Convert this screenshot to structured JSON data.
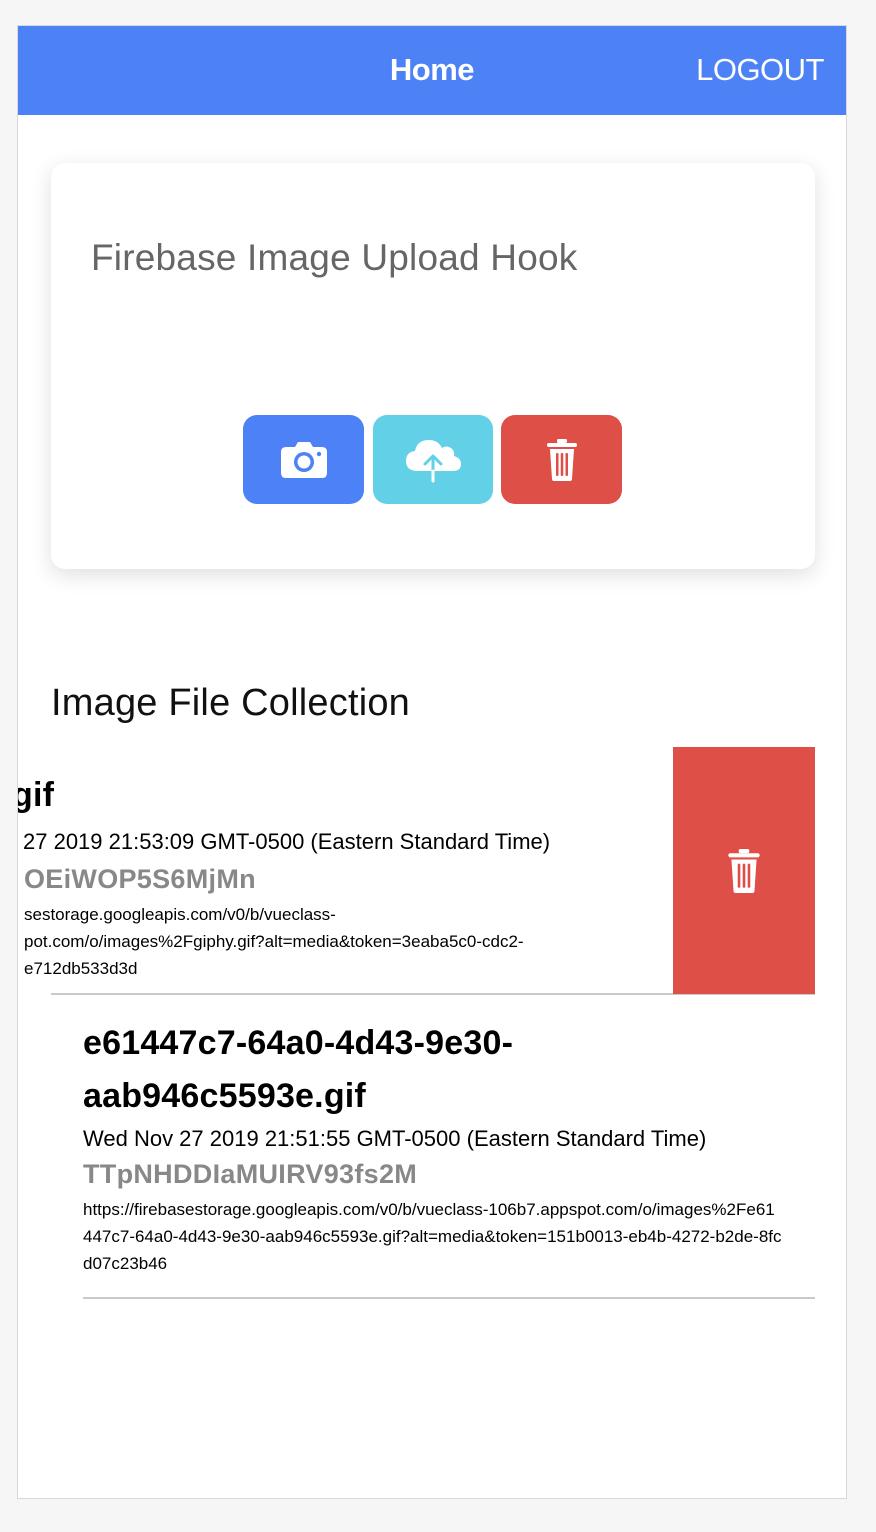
{
  "toolbar": {
    "title": "Home",
    "logout_label": "LOGOUT",
    "color": "#4c82f5"
  },
  "card": {
    "title": "Firebase Image Upload Hook",
    "buttons": [
      {
        "icon": "camera-icon",
        "color": "#4c82f5"
      },
      {
        "icon": "cloud-upload-icon",
        "color": "#62d0e6"
      },
      {
        "icon": "trash-icon",
        "color": "#dd4f47"
      }
    ]
  },
  "collection": {
    "title": "Image File Collection",
    "items": [
      {
        "name": "giphy.gif",
        "name_visible": "gif",
        "date_visible": "27 2019 21:53:09 GMT-0500 (Eastern Standard Time)",
        "id_visible": "OEiWOP5S6MjMn",
        "url_visible": "sestorage.googleapis.com/v0/b/vueclass-\npot.com/o/images%2Fgiphy.gif?alt=media&token=3eaba5c0-cdc2-\ne712db533d3d",
        "swiped": true,
        "swipe_action_icon": "trash-icon"
      },
      {
        "name": "e61447c7-64a0-4d43-9e30-aab946c5593e.gif",
        "date": "Wed Nov 27 2019 21:51:55 GMT-0500 (Eastern Standard Time)",
        "id": "TTpNHDDIaMUIRV93fs2M",
        "url": "https://firebasestorage.googleapis.com/v0/b/vueclass-106b7.appspot.com/o/images%2Fe61447c7-64a0-4d43-9e30-aab946c5593e.gif?alt=media&token=151b0013-eb4b-4272-b2de-8fcd07c23b46",
        "swiped": false
      }
    ]
  }
}
